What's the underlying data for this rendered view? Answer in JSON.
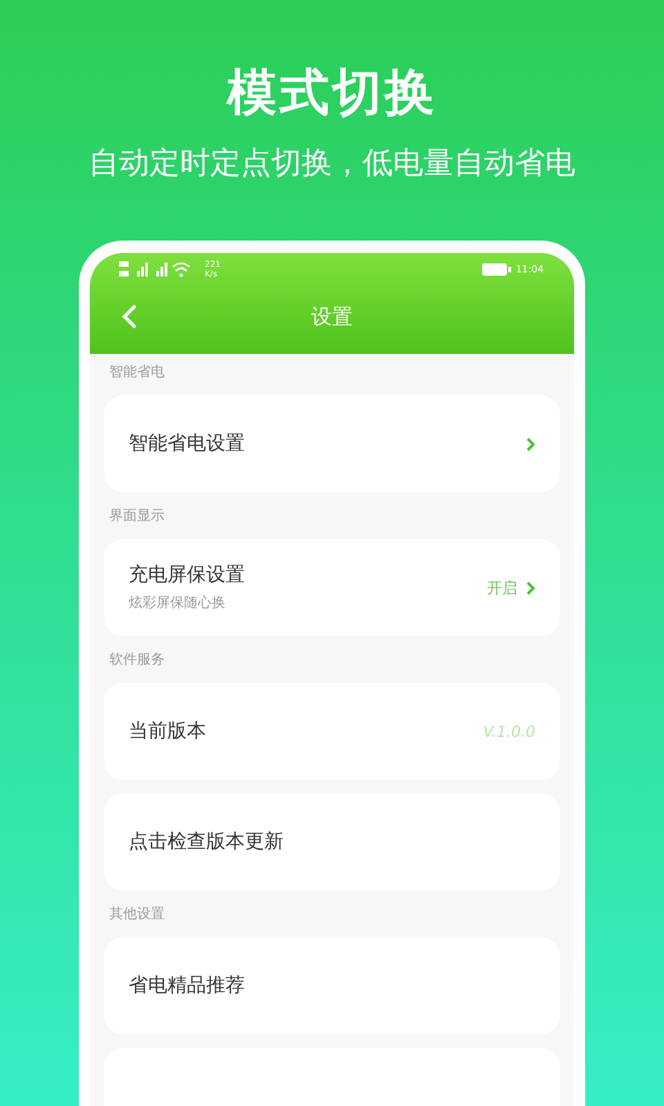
{
  "headline": "模式切换",
  "subtitle": "自动定时定点切换，低电量自动省电",
  "status_bar": {
    "speed": "221",
    "speed_unit": "K/s",
    "time": "11:04"
  },
  "app_bar": {
    "title": "设置"
  },
  "sections": [
    {
      "label": "智能省电",
      "items": [
        {
          "kind": "arrow",
          "title": "智能省电设置"
        }
      ]
    },
    {
      "label": "界面显示",
      "items": [
        {
          "kind": "value_arrow",
          "title": "充电屏保设置",
          "subtitle": "炫彩屏保随心换",
          "value": "开启"
        }
      ]
    },
    {
      "label": "软件服务",
      "items": [
        {
          "kind": "value",
          "title": "当前版本",
          "value": "V.1.0.0"
        },
        {
          "kind": "plain",
          "title": "点击检查版本更新"
        }
      ]
    },
    {
      "label": "其他设置",
      "items": [
        {
          "kind": "plain",
          "title": "省电精品推荐"
        }
      ]
    }
  ]
}
